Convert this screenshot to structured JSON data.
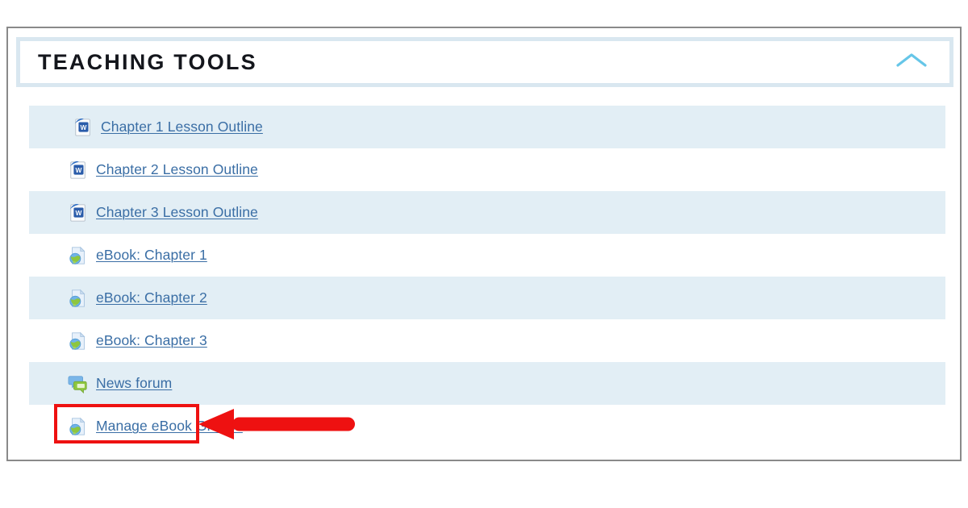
{
  "section": {
    "title": "TEACHING TOOLS",
    "collapse_icon": "chevron-up-icon",
    "collapse_icon_color": "#66c6e8",
    "header_border_color": "#d9e7f0",
    "card_border_color": "#8a8a8a"
  },
  "colors": {
    "row_shaded": "#e2eef5",
    "row_plain": "#ffffff",
    "link": "#3a6ea5",
    "annotation_red": "#ee1111",
    "title": "#14161c"
  },
  "resources": [
    {
      "label": "Chapter 1 Lesson Outline",
      "icon": "word-document-icon",
      "shaded": true,
      "indent": "extra"
    },
    {
      "label": "Chapter 2 Lesson Outline",
      "icon": "word-document-icon",
      "shaded": false,
      "indent": "normal"
    },
    {
      "label": "Chapter 3 Lesson Outline",
      "icon": "word-document-icon",
      "shaded": true,
      "indent": "normal"
    },
    {
      "label": "eBook: Chapter 1",
      "icon": "url-globe-page-icon",
      "shaded": false,
      "indent": "normal"
    },
    {
      "label": "eBook: Chapter 2",
      "icon": "url-globe-page-icon",
      "shaded": true,
      "indent": "normal"
    },
    {
      "label": "eBook: Chapter 3",
      "icon": "url-globe-page-icon",
      "shaded": false,
      "indent": "normal"
    },
    {
      "label": "News forum",
      "icon": "forum-speech-bubbles-icon",
      "shaded": true,
      "indent": "normal"
    },
    {
      "label": "Manage eBook Groups",
      "icon": "url-globe-page-icon",
      "shaded": false,
      "indent": "normal"
    }
  ],
  "annotation": {
    "highlight_target": "News forum",
    "arrow_direction": "left",
    "arrow_color": "#ee1111",
    "box_color": "#ee1111"
  }
}
